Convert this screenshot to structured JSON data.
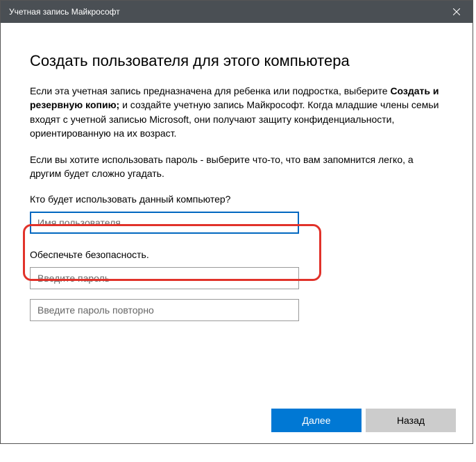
{
  "window": {
    "title": "Учетная запись Майкрософт"
  },
  "heading": "Создать пользователя для этого компьютера",
  "para1_part1": "Если эта учетная запись предназначена для ребенка или подростка, выберите ",
  "para1_bold": "Создать и резервную копию;",
  "para1_part2": " и создайте учетную запись Майкрософт. Когда младшие члены семьи входят с учетной записью Microsoft, они получают защиту конфиденциальности, ориентированную на их возраст.",
  "para2": "Если вы хотите использовать пароль - выберите что-то, что вам запомнится легко, а другим будет сложно угадать.",
  "username_label": "Кто будет использовать данный компьютер?",
  "username_placeholder": "Имя пользователя",
  "security_label": "Обеспечьте безопасность.",
  "password_placeholder": "Введите пароль",
  "password2_placeholder": "Введите пароль повторно",
  "buttons": {
    "next": "Далее",
    "back": "Назад"
  }
}
